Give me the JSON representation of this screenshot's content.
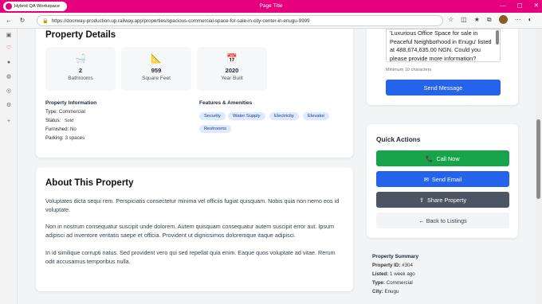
{
  "browser": {
    "workspace": "Hybrid QA Workspace",
    "page_title": "Page Title",
    "url": "https://doorway-production.up.railway.app/properties/spacious-commercial-space-for-sale-in-city-center-in-enugu-9999"
  },
  "details": {
    "title": "Property Details",
    "stats": [
      {
        "icon": "bath-icon",
        "glyph": "🛁",
        "value": "2",
        "label": "Bathrooms"
      },
      {
        "icon": "ruler-icon",
        "glyph": "📐",
        "value": "959",
        "label": "Square Feet"
      },
      {
        "icon": "calendar-icon",
        "glyph": "📅",
        "value": "2020",
        "label": "Year Built"
      }
    ],
    "info_heading": "Property Information",
    "info": [
      {
        "key": "Type:",
        "value": "Commercial"
      },
      {
        "key": "Status:",
        "value": "Sold"
      },
      {
        "key": "Furnished:",
        "value": "No"
      },
      {
        "key": "Parking:",
        "value": "3 spaces"
      }
    ],
    "features_heading": "Features & Amenities",
    "features": [
      "Security",
      "Water Supply",
      "Electricity",
      "Elevator",
      "Restrooms"
    ]
  },
  "about": {
    "title": "About This Property",
    "paragraphs": [
      "Voluptates dicta sequi rem. Perspiciatis consectetur minima vel officiis fugiat quisquam. Nobis quia non nemo eos id voluptate.",
      "Non in nostrum consequatur suscipit unde dolorem. Autem quisquam consequatur autem suscipit error aut. Ipsum adipisci ad inventore veritatis saepe et officia. Provident ut dignissimos doloremque itaque adipisci.",
      "In id similique corrupti natus. Sed provident vero qui sed repellat quia enim. Eaque quos voluptate ad vitae. Rerum odit accusamus temporibus nulla."
    ]
  },
  "contact": {
    "message_value": "'Luxurious Office Space for sale in Peaceful Neighborhood in Enugu' listed at 488,674,635.00 NGN. Could you please provide more information?",
    "hint": "Minimum 10 characters",
    "send_label": "Send Message"
  },
  "quick_actions": {
    "title": "Quick Actions",
    "call": "Call Now",
    "email": "Send Email",
    "share": "Share Property",
    "back": "← Back to Listings"
  },
  "summary": {
    "title": "Property Summary",
    "rows": [
      {
        "key": "Property ID:",
        "value": "#304"
      },
      {
        "key": "Listed:",
        "value": "1 week ago"
      },
      {
        "key": "Type:",
        "value": "Commercial"
      },
      {
        "key": "City:",
        "value": "Enugu"
      }
    ]
  },
  "colors": {
    "accent": "#e6007e",
    "blue": "#2563eb",
    "green": "#16a34a",
    "gray": "#4b5563"
  }
}
